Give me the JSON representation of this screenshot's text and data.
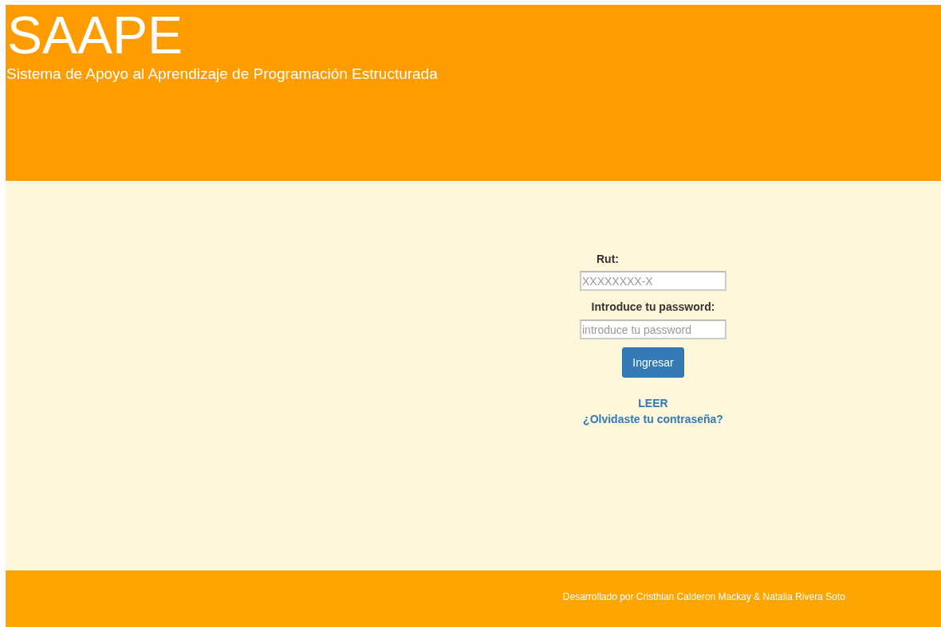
{
  "header": {
    "title": "SAAPE",
    "subtitle": "Sistema de Apoyo al Aprendizaje de Programación Estructurada"
  },
  "login": {
    "rut_label": "Rut:",
    "rut_placeholder": "XXXXXXXX-X",
    "password_label": "Introduce tu password:",
    "password_placeholder": "introduce tu password",
    "submit": "Ingresar",
    "links": [
      "LEER",
      "¿Olvidaste tu contraseña?"
    ]
  },
  "footer": {
    "credit": "Desarrollado por Cristhian Calderon Mackay & Natalia Rivera Soto"
  }
}
